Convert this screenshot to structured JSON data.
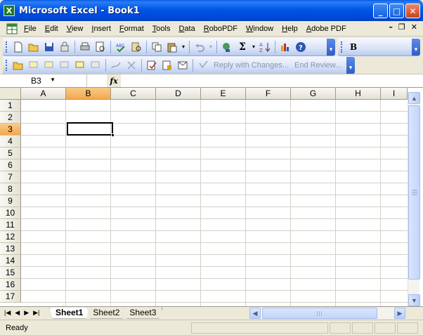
{
  "window": {
    "title": "Microsoft Excel - Book1",
    "app_icon": "X",
    "minimize": "_",
    "maximize": "□",
    "close": "✕"
  },
  "menu": {
    "items": [
      "File",
      "Edit",
      "View",
      "Insert",
      "Format",
      "Tools",
      "Data",
      "RoboPDF",
      "Window",
      "Help",
      "Adobe PDF"
    ],
    "doc_controls": {
      "minimize": "–",
      "restore": "❐",
      "close": "✕"
    }
  },
  "toolbar_standard": {
    "bold_label": "B",
    "sum_label": "Σ"
  },
  "toolbar_reviewing": {
    "reply_label": "Reply with Changes...",
    "end_review_label": "End Review..."
  },
  "formula_bar": {
    "name_box": "B3",
    "fx_label": "fx",
    "value": ""
  },
  "sheet": {
    "columns": [
      "A",
      "B",
      "C",
      "D",
      "E",
      "F",
      "G",
      "H",
      "I"
    ],
    "rows": [
      "1",
      "2",
      "3",
      "4",
      "5",
      "6",
      "7",
      "8",
      "9",
      "10",
      "11",
      "12",
      "13",
      "14",
      "15",
      "16",
      "17"
    ],
    "active_column": "B",
    "active_row": "3"
  },
  "sheet_tabs": [
    "Sheet1",
    "Sheet2",
    "Sheet3"
  ],
  "active_tab": "Sheet1",
  "status": {
    "text": "Ready"
  },
  "colors": {
    "title_bar": "#0055e5",
    "active_header": "#f5a84b",
    "toolbar": "#d9e3f7"
  }
}
